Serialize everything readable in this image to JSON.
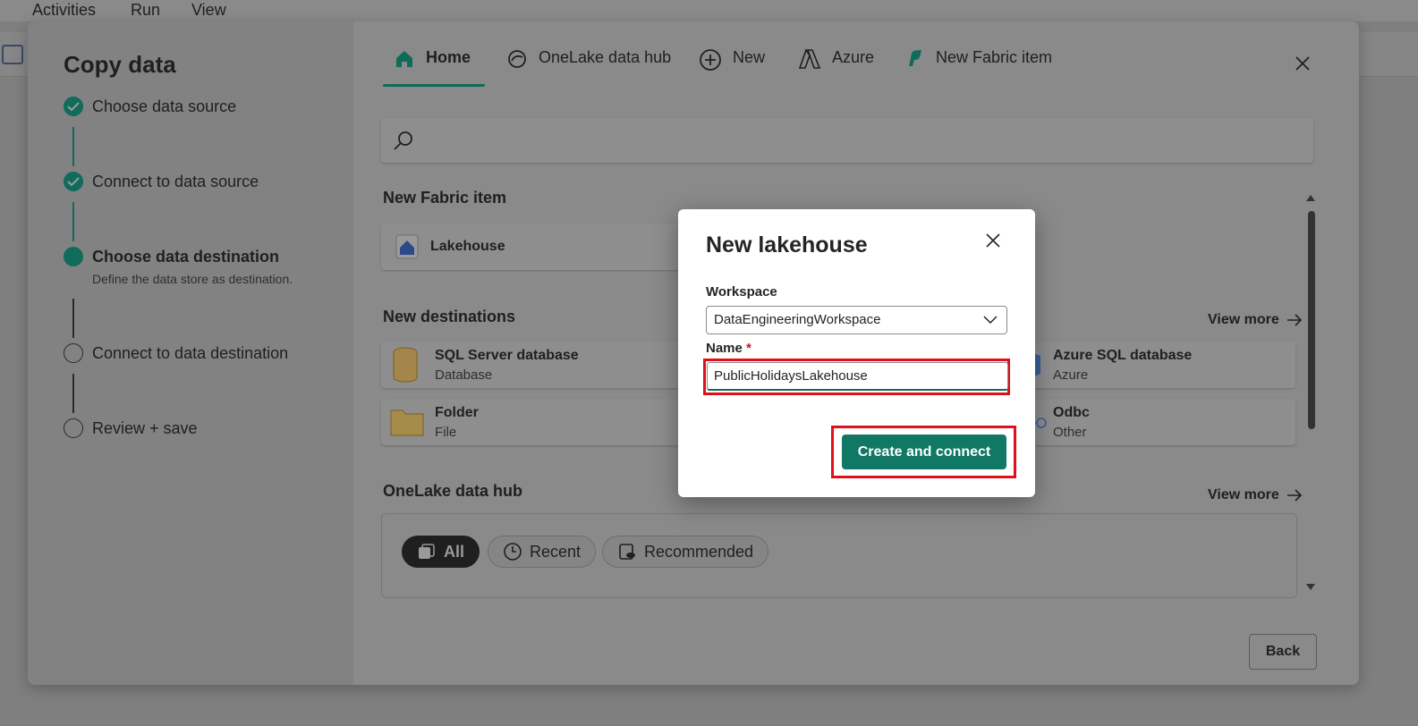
{
  "app_menu": [
    "Activities",
    "Run",
    "View"
  ],
  "wizard": {
    "title": "Copy data",
    "steps": [
      {
        "label": "Choose data source",
        "state": "done"
      },
      {
        "label": "Connect to data source",
        "state": "done"
      },
      {
        "label": "Choose data destination",
        "state": "current",
        "description": "Define the data store as destination."
      },
      {
        "label": "Connect to data destination",
        "state": "todo"
      },
      {
        "label": "Review + save",
        "state": "todo"
      }
    ],
    "tabs": [
      {
        "label": "Home",
        "icon": "home-icon",
        "active": true
      },
      {
        "label": "OneLake data hub",
        "icon": "onelake-icon"
      },
      {
        "label": "New",
        "icon": "plus-circle-icon"
      },
      {
        "label": "Azure",
        "icon": "azure-icon"
      },
      {
        "label": "New Fabric item",
        "icon": "fabric-icon"
      }
    ],
    "search_placeholder": "",
    "new_fabric_item": {
      "title": "New Fabric item",
      "cards": [
        {
          "title": "Lakehouse",
          "icon": "lakehouse-icon"
        }
      ]
    },
    "new_destinations": {
      "title": "New destinations",
      "view_more": "View more",
      "cards": [
        {
          "title": "SQL Server database",
          "subtitle": "Database",
          "icon": "database-icon"
        },
        {
          "title": "Azure SQL database",
          "subtitle": "Azure",
          "icon": "azure-sql-icon"
        },
        {
          "title": "Folder",
          "subtitle": "File",
          "icon": "folder-icon"
        },
        {
          "title": "Odbc",
          "subtitle": "Other",
          "icon": "odbc-icon"
        }
      ]
    },
    "onelake_hub": {
      "title": "OneLake data hub",
      "view_more": "View more",
      "filters": [
        {
          "label": "All",
          "active": true
        },
        {
          "label": "Recent"
        },
        {
          "label": "Recommended"
        }
      ]
    },
    "back_label": "Back"
  },
  "dialog": {
    "title": "New lakehouse",
    "workspace_label": "Workspace",
    "workspace_value": "DataEngineeringWorkspace",
    "name_label": "Name",
    "name_required_marker": "*",
    "name_value": "PublicHolidaysLakehouse",
    "submit_label": "Create and connect"
  },
  "colors": {
    "accent": "#117865",
    "highlight": "#e0101a",
    "overlay": "#7f7f7f"
  }
}
